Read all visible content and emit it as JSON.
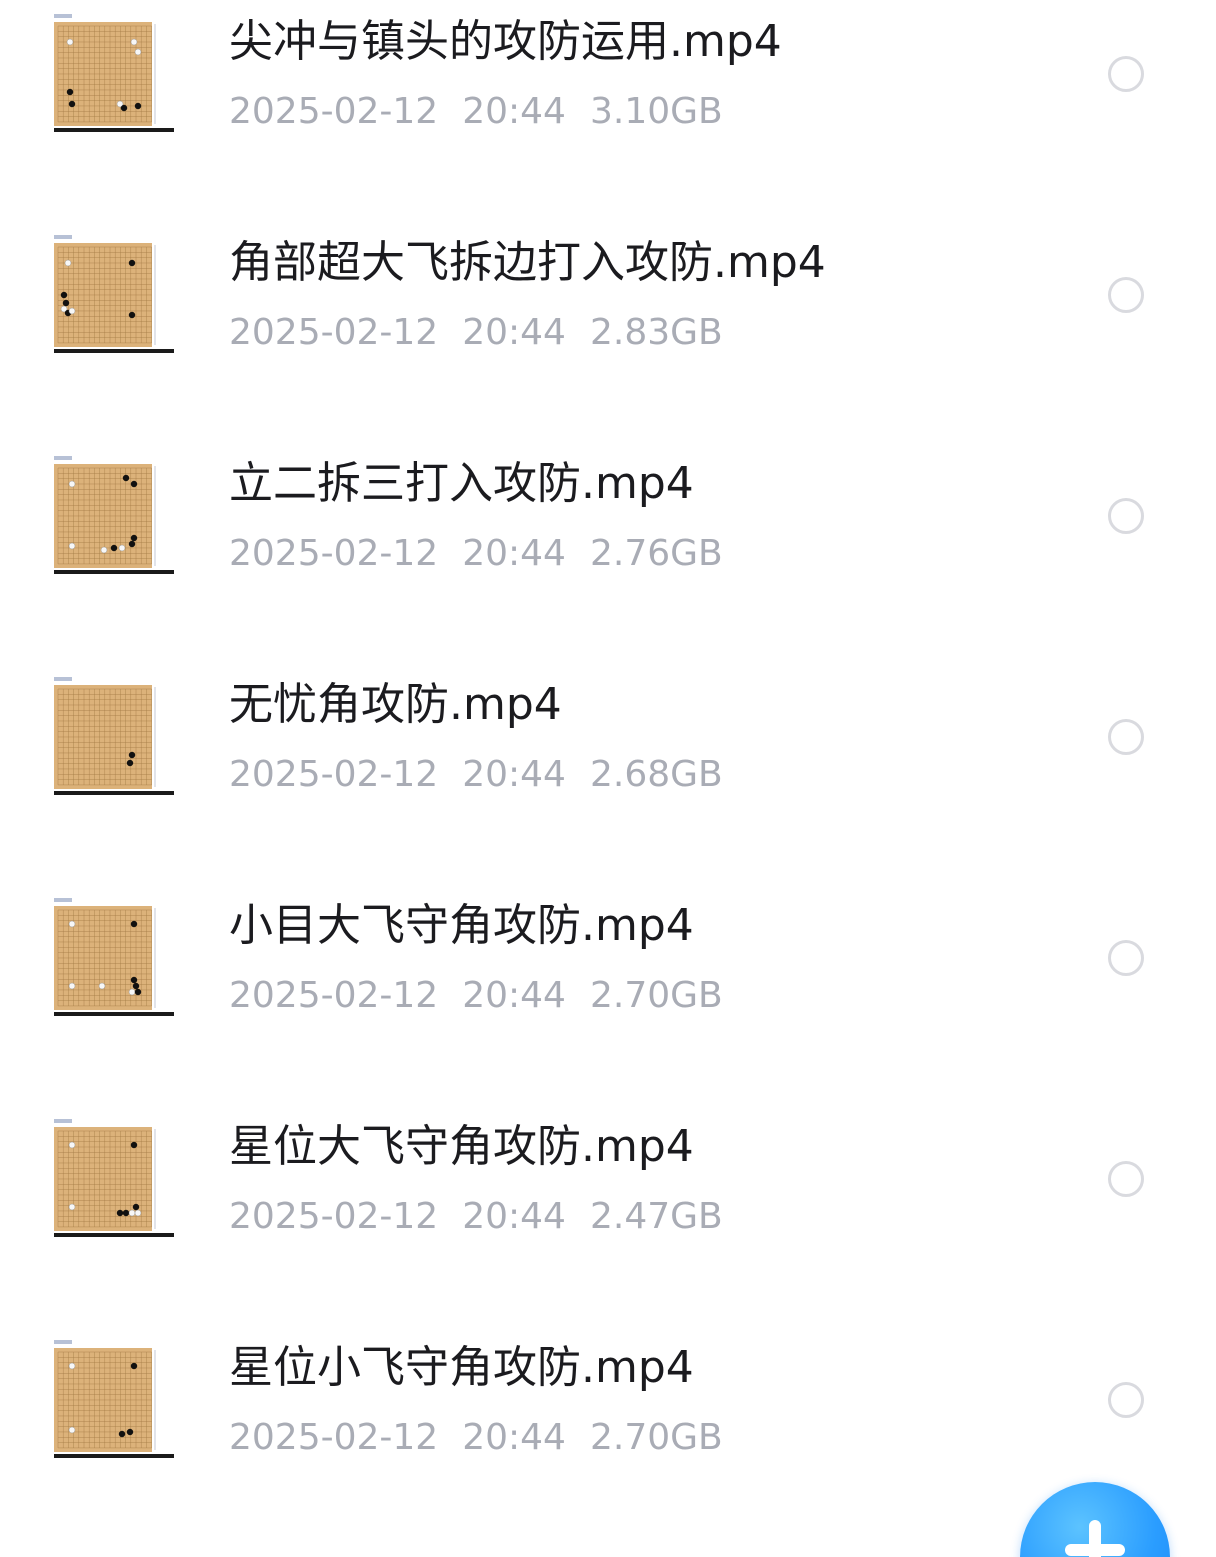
{
  "files": [
    {
      "name": "尖冲与镇头的攻防运用.mp4",
      "date": "2025-02-12",
      "time": "20:44",
      "size": "3.10GB",
      "thumbnail_icon": "go-board-video-thumbnail",
      "selected": false
    },
    {
      "name": "角部超大飞拆边打入攻防.mp4",
      "date": "2025-02-12",
      "time": "20:44",
      "size": "2.83GB",
      "thumbnail_icon": "go-board-video-thumbnail",
      "selected": false
    },
    {
      "name": "立二拆三打入攻防.mp4",
      "date": "2025-02-12",
      "time": "20:44",
      "size": "2.76GB",
      "thumbnail_icon": "go-board-video-thumbnail",
      "selected": false
    },
    {
      "name": "无忧角攻防.mp4",
      "date": "2025-02-12",
      "time": "20:44",
      "size": "2.68GB",
      "thumbnail_icon": "go-board-video-thumbnail",
      "selected": false
    },
    {
      "name": "小目大飞守角攻防.mp4",
      "date": "2025-02-12",
      "time": "20:44",
      "size": "2.70GB",
      "thumbnail_icon": "go-board-video-thumbnail",
      "selected": false
    },
    {
      "name": "星位大飞守角攻防.mp4",
      "date": "2025-02-12",
      "time": "20:44",
      "size": "2.47GB",
      "thumbnail_icon": "go-board-video-thumbnail",
      "selected": false
    },
    {
      "name": "星位小飞守角攻防.mp4",
      "date": "2025-02-12",
      "time": "20:44",
      "size": "2.70GB",
      "thumbnail_icon": "go-board-video-thumbnail",
      "selected": false
    }
  ],
  "fab": {
    "icon": "plus-icon"
  },
  "colors": {
    "title_text": "#1b1b1f",
    "meta_text": "#a9acb5",
    "select_border": "#d9dadf",
    "fab_blue": "#2a9dff",
    "board_wood": "#dcb27a"
  }
}
